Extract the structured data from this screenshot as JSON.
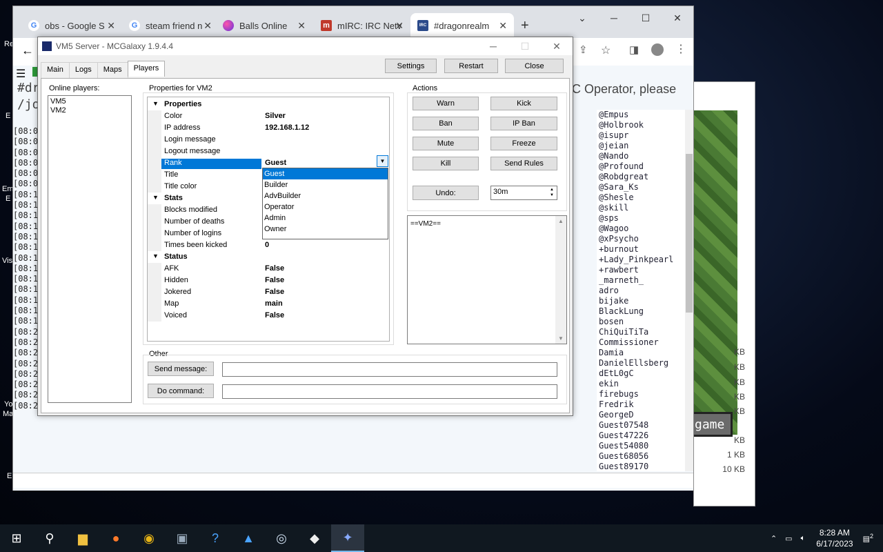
{
  "desktop": {
    "left_icons": [
      "Re",
      "E",
      "Em",
      "E",
      "Vis",
      "Yo",
      "Ma",
      "E"
    ],
    "mc_button": "game",
    "file_sizes": [
      "KB",
      "KB",
      "KB",
      "KB",
      "KB",
      "KB",
      "1 KB",
      "10 KB"
    ]
  },
  "browser": {
    "tabs": [
      {
        "title": "obs - Google S",
        "color": "#4285f4",
        "fav": "G"
      },
      {
        "title": "steam friend n",
        "color": "#4285f4",
        "fav": "G"
      },
      {
        "title": "Balls Online",
        "color": "#6b5bd6",
        "fav": ""
      },
      {
        "title": "mIRC: IRC Netv",
        "color": "#c0392b",
        "fav": "m"
      },
      {
        "title": "#dragonrealm",
        "color": "#2b4a8a",
        "fav": "IRC"
      }
    ],
    "new_tab": "+",
    "irc_title": "#dr",
    "irc_join": "/joi",
    "irc_notice": "C Operator, please",
    "log_lines": [
      "[08:0",
      "[08:0",
      "[08:0",
      "[08:0",
      "[08:0",
      "[08:0",
      "[08:1",
      "[08:1",
      "[08:1",
      "[08:1",
      "[08:1",
      "[08:1",
      "[08:1",
      "[08:1",
      "[08:1",
      "[08:1",
      "[08:1",
      "[08:1",
      "[08:1",
      "[08:2",
      "[08:2",
      "[08:2",
      "[08:2",
      "[08:2",
      "[08:2",
      "[08:2",
      "[08:2"
    ],
    "nicks": [
      "@Empus",
      "@Holbrook",
      "@isupr",
      "@jeian",
      "@Nando",
      "@Profound",
      "@Robdgreat",
      "@Sara_Ks",
      "@Shesle",
      "@skill",
      "@sps",
      "@Wagoo",
      "@xPsycho",
      "+burnout",
      "+Lady_Pinkpearl",
      "+rawbert",
      "_marneth_",
      "adro",
      "bijake",
      "BlackLung",
      "bosen",
      "ChiQuiTiTa",
      "Commissioner",
      "Damia",
      "DanielEllsberg",
      "dEtL0gC",
      "ekin",
      "firebugs",
      "Fredrik",
      "GeorgeD",
      "Guest07548",
      "Guest47226",
      "Guest54080",
      "Guest68056",
      "Guest89170"
    ]
  },
  "app": {
    "title": "VM5 Server - MCGalaxy 1.9.4.4",
    "tabs": [
      "Main",
      "Logs",
      "Maps",
      "Players"
    ],
    "active_tab": "Players",
    "top_buttons": {
      "settings": "Settings",
      "restart": "Restart",
      "close": "Close"
    },
    "online_label": "Online players:",
    "online_players": [
      "VM5",
      "VM2"
    ],
    "props_label": "Properties for VM2",
    "categories": {
      "properties": "Properties",
      "stats": "Stats",
      "status": "Status"
    },
    "props": [
      {
        "name": "Color",
        "value": "Silver"
      },
      {
        "name": "IP address",
        "value": "192.168.1.12"
      },
      {
        "name": "Login message",
        "value": ""
      },
      {
        "name": "Logout message",
        "value": ""
      },
      {
        "name": "Rank",
        "value": "Guest"
      },
      {
        "name": "Title",
        "value": ""
      },
      {
        "name": "Title color",
        "value": ""
      }
    ],
    "stats": [
      {
        "name": "Blocks modified",
        "value": ""
      },
      {
        "name": "Number of deaths",
        "value": ""
      },
      {
        "name": "Number of logins",
        "value": ""
      },
      {
        "name": "Times been kicked",
        "value": "0"
      }
    ],
    "status": [
      {
        "name": "AFK",
        "value": "False"
      },
      {
        "name": "Hidden",
        "value": "False"
      },
      {
        "name": "Jokered",
        "value": "False"
      },
      {
        "name": "Map",
        "value": "main"
      },
      {
        "name": "Voiced",
        "value": "False"
      }
    ],
    "rank_options": [
      "Guest",
      "Builder",
      "AdvBuilder",
      "Operator",
      "Admin",
      "Owner"
    ],
    "actions_label": "Actions",
    "actions": {
      "warn": "Warn",
      "kick": "Kick",
      "ban": "Ban",
      "ipban": "IP Ban",
      "mute": "Mute",
      "freeze": "Freeze",
      "kill": "Kill",
      "sendrules": "Send Rules",
      "undo": "Undo:"
    },
    "undo_value": "30m",
    "log_text": "==VM2==",
    "other_label": "Other",
    "send_message": "Send message:",
    "do_command": "Do command:",
    "send_message_value": "",
    "do_command_value": ""
  },
  "taskbar": {
    "time": "8:28 AM",
    "date": "6/17/2023",
    "notifications": "2"
  }
}
